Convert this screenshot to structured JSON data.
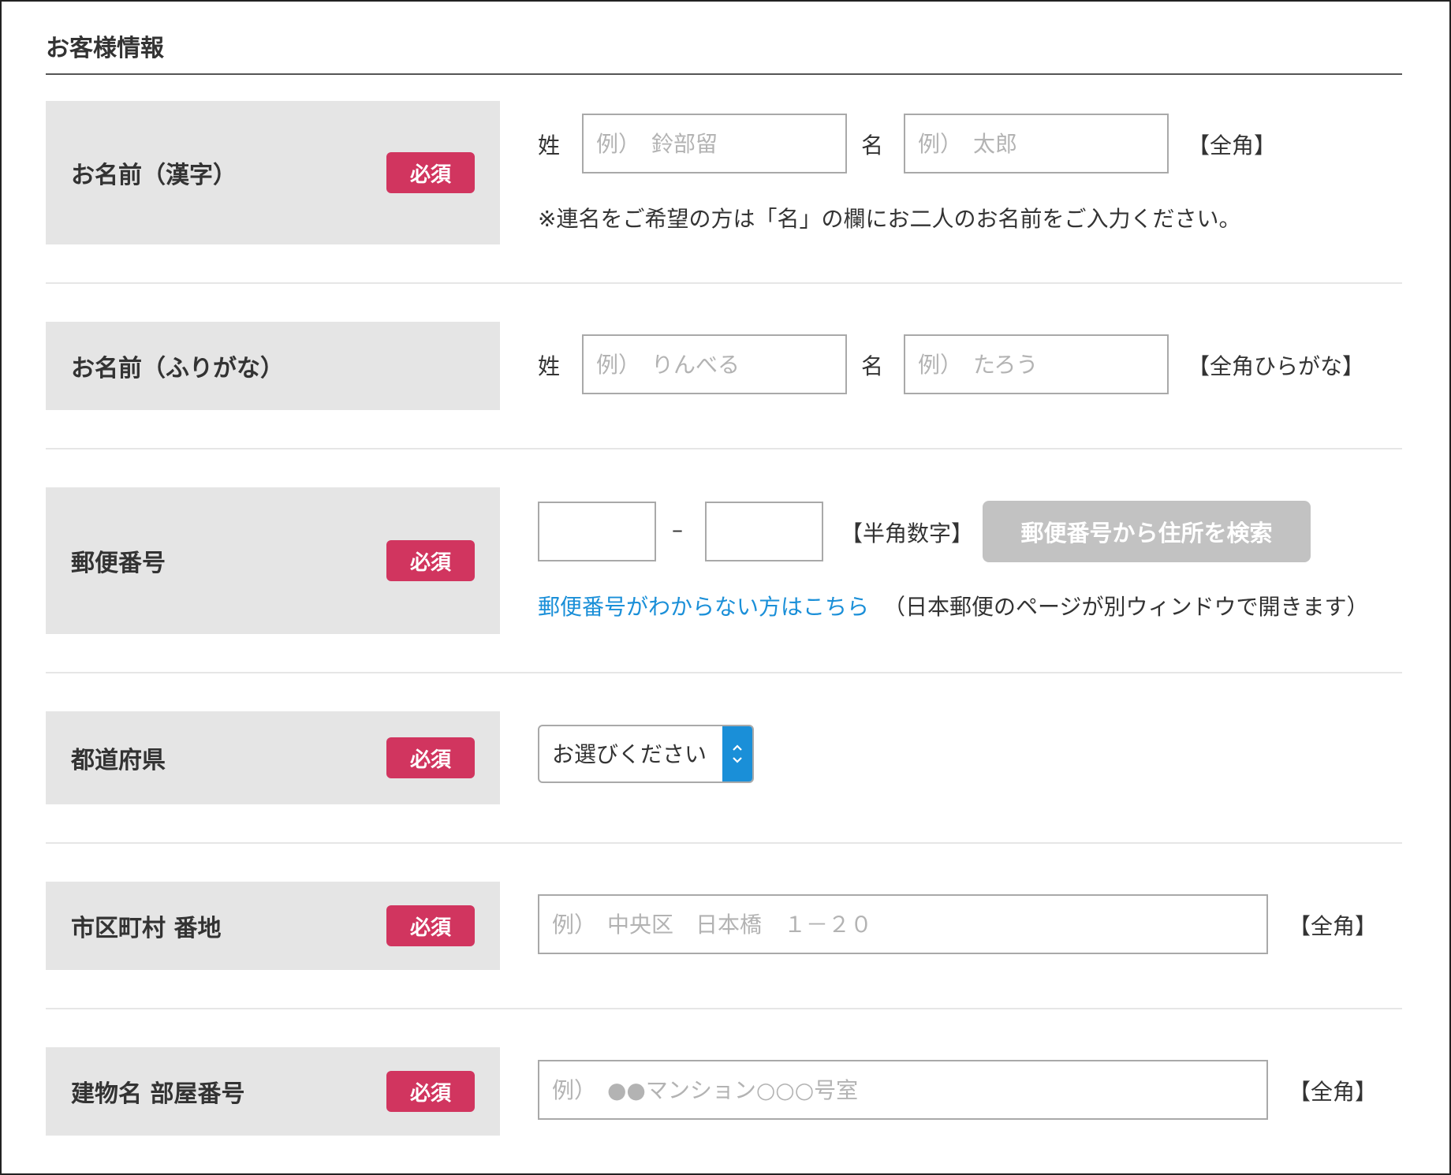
{
  "section": {
    "title": "お客様情報"
  },
  "required_label": "必須",
  "name_kanji": {
    "label": "お名前（漢字）",
    "last_prefix": "姓",
    "last_placeholder": "例）　鈴部留",
    "first_prefix": "名",
    "first_placeholder": "例）　太郎",
    "hint": "【全角】",
    "note": "※連名をご希望の方は「名」の欄にお二人のお名前をご入力ください。"
  },
  "name_kana": {
    "label": "お名前（ふりがな）",
    "last_prefix": "姓",
    "last_placeholder": "例）　りんべる",
    "first_prefix": "名",
    "first_placeholder": "例）　たろう",
    "hint": "【全角ひらがな】"
  },
  "postal": {
    "label": "郵便番号",
    "separator": "–",
    "hint": "【半角数字】",
    "search_button": "郵便番号から住所を検索",
    "help_link": "郵便番号がわからない方はこちら",
    "help_note": "（日本郵便のページが別ウィンドウで開きます）"
  },
  "prefecture": {
    "label": "都道府県",
    "selected": "お選びください"
  },
  "address": {
    "label": "市区町村 番地",
    "placeholder": "例）　中央区　日本橋　１－２０",
    "hint": "【全角】"
  },
  "building": {
    "label": "建物名 部屋番号",
    "placeholder": "例）　●●マンション○○○号室",
    "hint": "【全角】"
  },
  "colors": {
    "required_badge": "#d1355f",
    "link": "#1a8fd8",
    "label_bg": "#e5e5e5",
    "disabled_button": "#c2c2c2"
  }
}
